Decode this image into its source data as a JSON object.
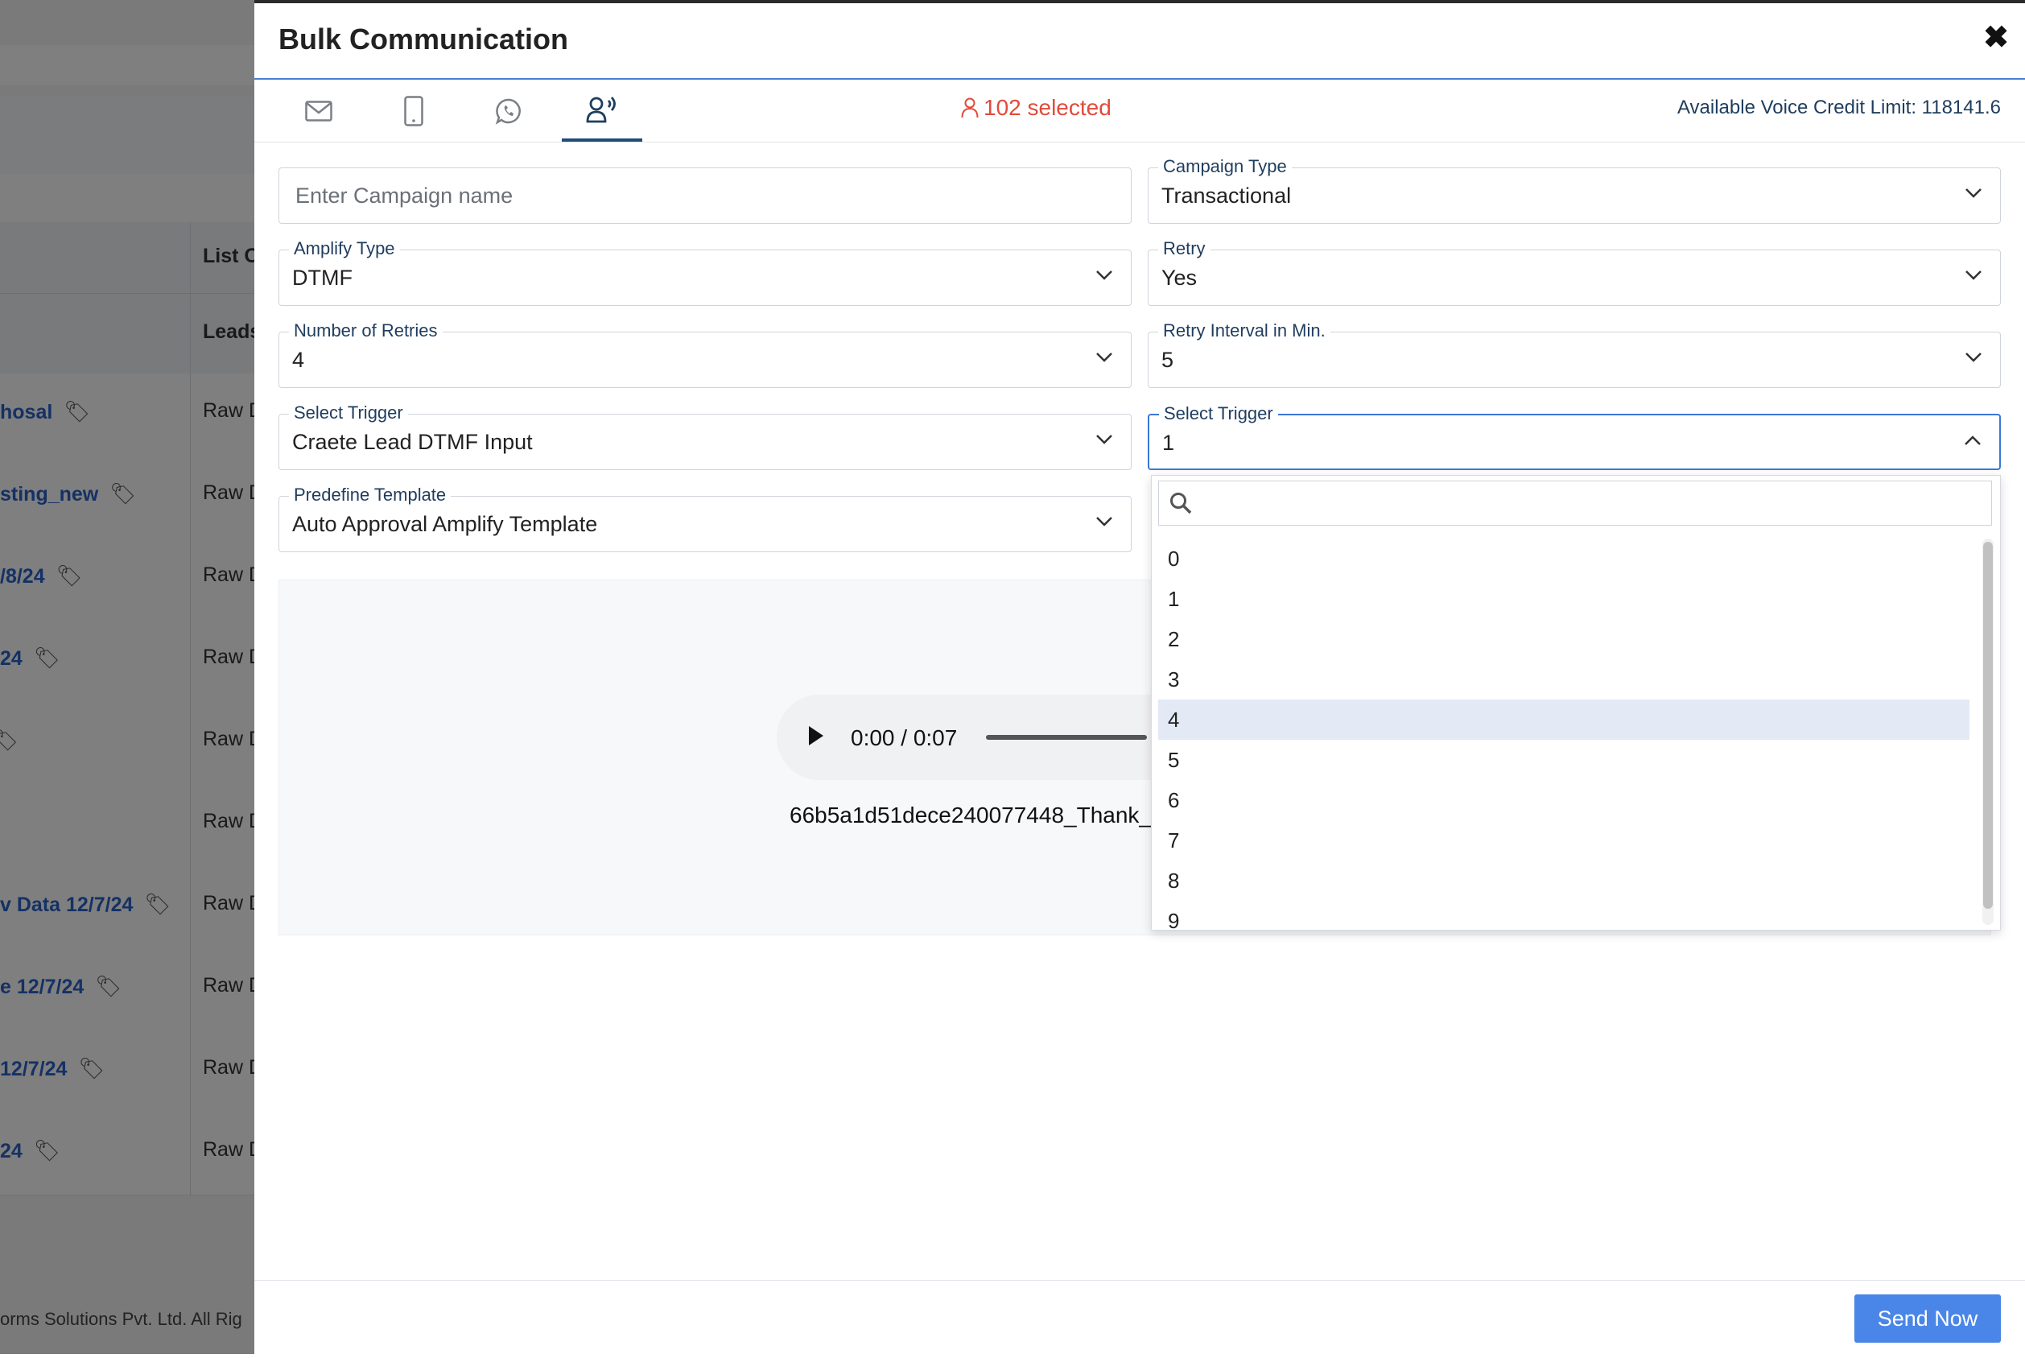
{
  "background": {
    "headers": [
      "List O",
      "Leads"
    ],
    "rows": [
      {
        "name": "hosal",
        "source": "Raw D"
      },
      {
        "name": "sting_new",
        "source": "Raw D"
      },
      {
        "name": "/8/24",
        "source": "Raw D"
      },
      {
        "name": "24",
        "source": "Raw D"
      },
      {
        "name": "",
        "source": "Raw D"
      },
      {
        "name": "",
        "source": "Raw D"
      },
      {
        "name": "v Data 12/7/24",
        "source": "Raw D"
      },
      {
        "name": "e 12/7/24",
        "source": "Raw D"
      },
      {
        "name": "12/7/24",
        "source": "Raw D"
      },
      {
        "name": "24",
        "source": "Raw D"
      }
    ],
    "footer": "orms Solutions Pvt. Ltd. All Rig"
  },
  "modal": {
    "title": "Bulk Communication",
    "close_icon": "close-icon",
    "tabs": [
      {
        "icon": "email-icon"
      },
      {
        "icon": "sms-phone-icon"
      },
      {
        "icon": "whatsapp-icon"
      },
      {
        "icon": "voice-icon",
        "active": true
      }
    ],
    "selected_text": "102 selected",
    "credit_text": "Available Voice Credit Limit: 118141.6",
    "accent_color": "#4a86e8",
    "selected_color": "#e24a3b"
  },
  "form": {
    "campaign_name_placeholder": "Enter Campaign name",
    "campaign_type": {
      "label": "Campaign Type",
      "value": "Transactional"
    },
    "amplify_type": {
      "label": "Amplify Type",
      "value": "DTMF"
    },
    "retry": {
      "label": "Retry",
      "value": "Yes"
    },
    "num_retries": {
      "label": "Number of Retries",
      "value": "4"
    },
    "retry_interval": {
      "label": "Retry Interval in Min.",
      "value": "5"
    },
    "trigger_left": {
      "label": "Select Trigger",
      "value": "Craete Lead DTMF Input"
    },
    "trigger_right": {
      "label": "Select Trigger",
      "value": "1"
    },
    "template": {
      "label": "Predefine Template",
      "value": "Auto Approval Amplify Template"
    }
  },
  "audio": {
    "time": "0:00 / 0:07",
    "filename": "66b5a1d51dece240077448_Thank_"
  },
  "dropdown": {
    "search_value": "",
    "options": [
      "0",
      "1",
      "2",
      "3",
      "4",
      "5",
      "6",
      "7",
      "8",
      "9"
    ],
    "highlighted": "4"
  },
  "footer": {
    "send_label": "Send Now"
  }
}
